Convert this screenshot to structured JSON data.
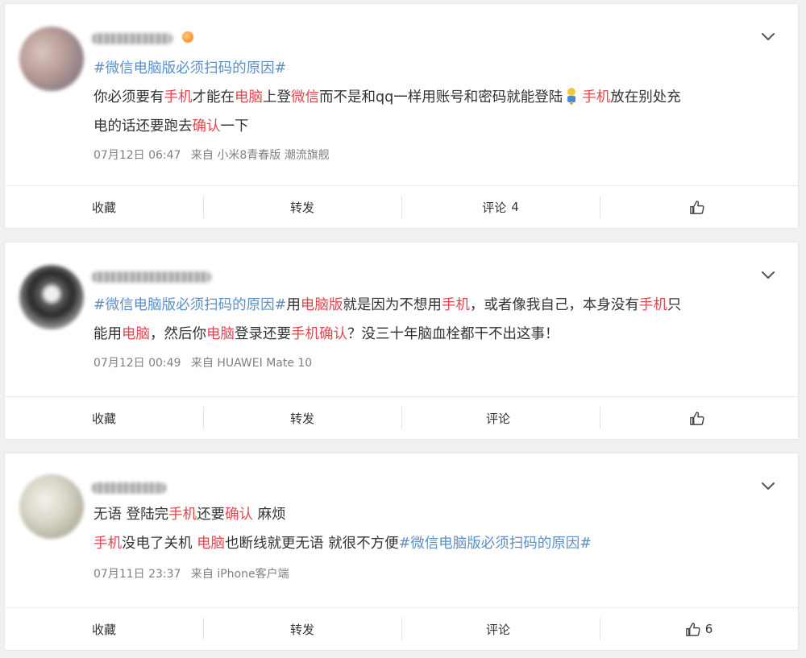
{
  "colors": {
    "topic": "#5d8fc7",
    "keyword": "#e0464f",
    "meta": "#808080",
    "background": "#f0f0f0"
  },
  "posts": [
    {
      "content_lines": [
        [
          {
            "t": "#微信电脑版必须扫码的原因#",
            "c": "tag"
          }
        ],
        [
          {
            "t": "你必须要有",
            "c": ""
          },
          {
            "t": "手机",
            "c": "kw"
          },
          {
            "t": "才能在",
            "c": ""
          },
          {
            "t": "电脑",
            "c": "kw"
          },
          {
            "t": "上登",
            "c": ""
          },
          {
            "t": "微信",
            "c": "kw"
          },
          {
            "t": "而不是和qq一样用账号和密码就能登陆",
            "c": ""
          },
          {
            "t": "[emoji]",
            "c": "emoji"
          },
          {
            "t": "手机",
            "c": "kw"
          },
          {
            "t": "放在别处充",
            "c": ""
          }
        ],
        [
          {
            "t": "电的话还要跑去",
            "c": ""
          },
          {
            "t": "确认",
            "c": "kw"
          },
          {
            "t": "一下",
            "c": ""
          }
        ]
      ],
      "date": "07月12日 06:47",
      "source": "来自 小米8青春版 潮流旗舰",
      "actions": {
        "favorite": "收藏",
        "repost": "转发",
        "comment": "评论",
        "comment_count": "4",
        "like_count": ""
      }
    },
    {
      "content_lines": [
        [
          {
            "t": "#微信电脑版必须扫码的原因#",
            "c": "tag"
          },
          {
            "t": "用",
            "c": ""
          },
          {
            "t": "电脑版",
            "c": "kw"
          },
          {
            "t": "就是因为不想用",
            "c": ""
          },
          {
            "t": "手机",
            "c": "kw"
          },
          {
            "t": "，或者像我自己，本身没有",
            "c": ""
          },
          {
            "t": "手机",
            "c": "kw"
          },
          {
            "t": "只",
            "c": ""
          }
        ],
        [
          {
            "t": "能用",
            "c": ""
          },
          {
            "t": "电脑",
            "c": "kw"
          },
          {
            "t": "，然后你",
            "c": ""
          },
          {
            "t": "电脑",
            "c": "kw"
          },
          {
            "t": "登录还要",
            "c": ""
          },
          {
            "t": "手机确认",
            "c": "kw"
          },
          {
            "t": "？没三十年脑血栓都干不出这事！",
            "c": ""
          }
        ]
      ],
      "date": "07月12日 00:49",
      "source": "来自 HUAWEI Mate 10",
      "actions": {
        "favorite": "收藏",
        "repost": "转发",
        "comment": "评论",
        "comment_count": "",
        "like_count": ""
      }
    },
    {
      "content_lines": [
        [
          {
            "t": "无语 登陆完",
            "c": ""
          },
          {
            "t": "手机",
            "c": "kw"
          },
          {
            "t": "还要",
            "c": ""
          },
          {
            "t": "确认",
            "c": "kw"
          },
          {
            "t": " 麻烦",
            "c": ""
          }
        ],
        [
          {
            "t": "手机",
            "c": "kw"
          },
          {
            "t": "没电了关机 ",
            "c": ""
          },
          {
            "t": "电脑",
            "c": "kw"
          },
          {
            "t": "也断线就更无语 就很不方便",
            "c": ""
          },
          {
            "t": "#微信电脑版必须扫码的原因#",
            "c": "tag"
          }
        ]
      ],
      "date": "07月11日 23:37",
      "source": "来自 iPhone客户端",
      "actions": {
        "favorite": "收藏",
        "repost": "转发",
        "comment": "评论",
        "comment_count": "",
        "like_count": "6"
      }
    }
  ]
}
